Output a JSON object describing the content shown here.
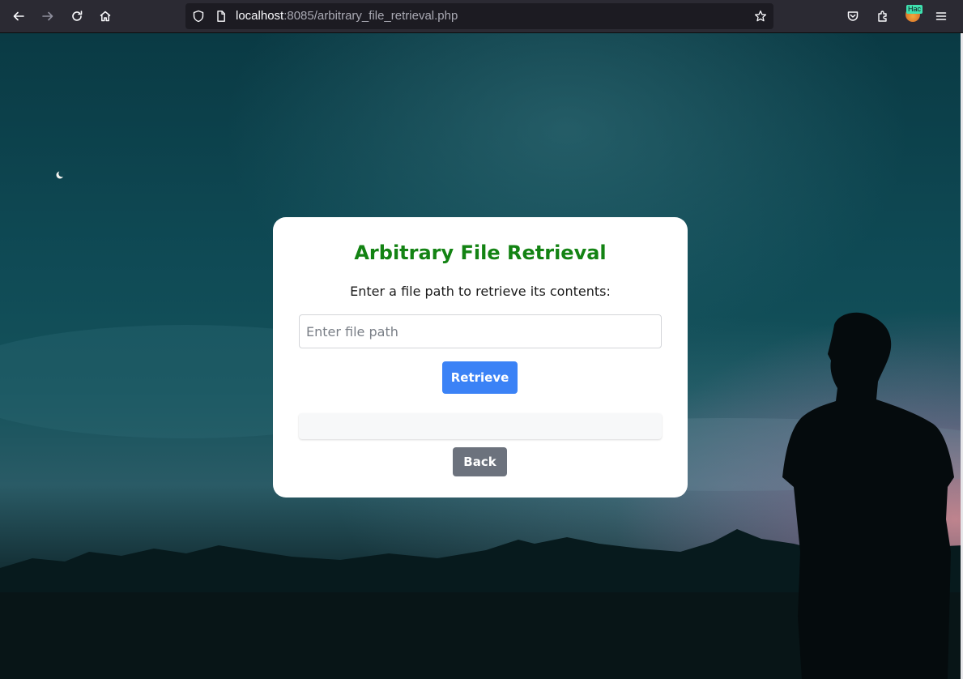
{
  "browser": {
    "url_host": "localhost",
    "url_rest": ":8085/arbitrary_file_retrieval.php",
    "extension_badge": "Hac",
    "icons": [
      "back-arrow-icon",
      "forward-arrow-icon",
      "reload-icon",
      "home-icon",
      "shield-icon",
      "page-icon",
      "bookmark-star-icon",
      "pocket-icon",
      "extensions-icon",
      "hamburger-menu-icon"
    ]
  },
  "page": {
    "title": "Arbitrary File Retrieval",
    "subtitle": "Enter a file path to retrieve its contents:",
    "input": {
      "placeholder": "Enter file path",
      "value": ""
    },
    "retrieve_label": "Retrieve",
    "back_label": "Back",
    "result_text": ""
  },
  "colors": {
    "title_green": "#138313",
    "retrieve_blue": "#3b82f6",
    "back_gray": "#6c727d"
  }
}
